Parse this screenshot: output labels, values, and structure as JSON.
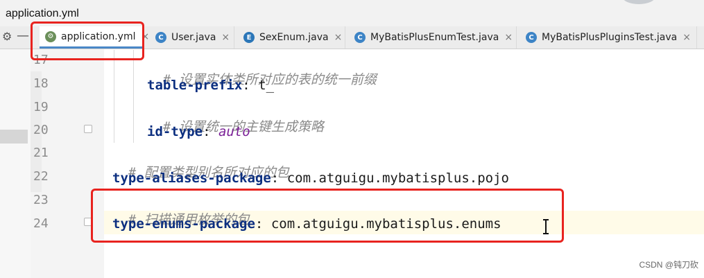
{
  "window": {
    "title": "application.yml"
  },
  "tabs": [
    {
      "label": "application.yml",
      "icon": "yml-file-icon",
      "active": true
    },
    {
      "label": "User.java",
      "icon": "java-class-icon",
      "active": false
    },
    {
      "label": "SexEnum.java",
      "icon": "java-enum-icon",
      "active": false
    },
    {
      "label": "MyBatisPlusEnumTest.java",
      "icon": "java-test-class-icon",
      "active": false
    },
    {
      "label": "MyBatisPlusPluginsTest.java",
      "icon": "java-test-class-icon",
      "active": false
    }
  ],
  "tab_close_glyph": "×",
  "editor": {
    "lines": [
      {
        "number": "17",
        "comment": "# 设置实体类所对应的表的统一前缀"
      },
      {
        "number": "18",
        "key": "table-prefix",
        "value": "t_"
      },
      {
        "number": "19",
        "comment": "# 设置统一的主键生成策略"
      },
      {
        "number": "20",
        "key": "id-type",
        "value": "auto"
      },
      {
        "number": "21",
        "comment": "# 配置类型别名所对应的包"
      },
      {
        "number": "22",
        "key": "type-aliases-package",
        "value": "com.atguigu.mybatisplus.pojo"
      },
      {
        "number": "23",
        "comment": "# 扫描通用枚举的包"
      },
      {
        "number": "24",
        "key": "type-enums-package",
        "value": "com.atguigu.mybatisplus.enums"
      }
    ],
    "colon": ":"
  },
  "watermark": "CSDN @钝刀砍",
  "colors": {
    "highlight_box": "#e8231f",
    "comment": "#8a8a8a",
    "key": "#0c2f80",
    "keyword_value": "#7a1f96"
  }
}
